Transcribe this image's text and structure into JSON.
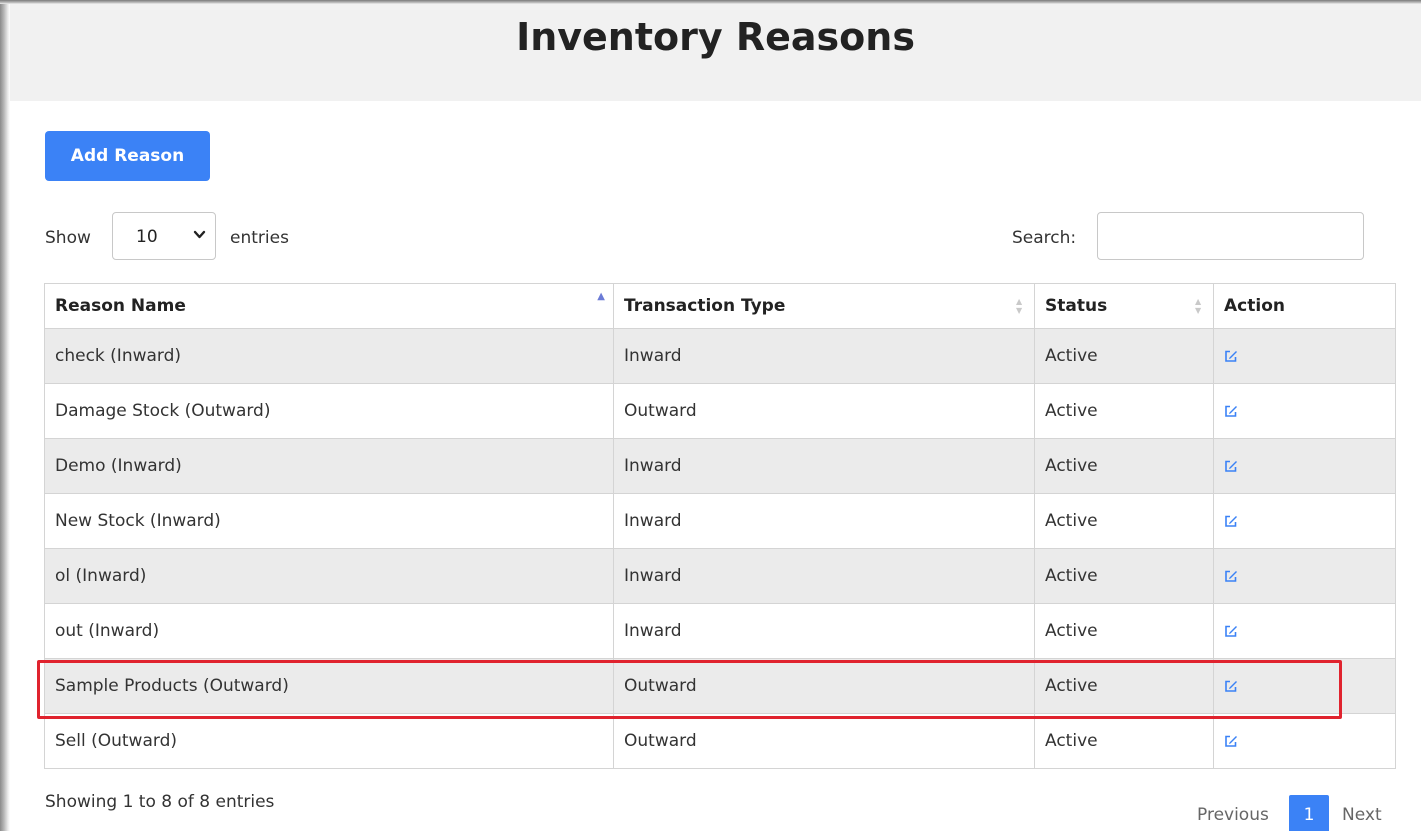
{
  "page": {
    "title": "Inventory Reasons"
  },
  "toolbar": {
    "add_label": "Add Reason"
  },
  "length_control": {
    "show_label": "Show",
    "value": "10",
    "suffix_label": "entries"
  },
  "search": {
    "label": "Search:",
    "value": ""
  },
  "table": {
    "columns": [
      "Reason Name",
      "Transaction Type",
      "Status",
      "Action"
    ],
    "sorted_column": "Reason Name",
    "sort_direction": "ascending",
    "rows": [
      {
        "reason": "check (Inward)",
        "type": "Inward",
        "status": "Active",
        "action_icon": "edit-icon"
      },
      {
        "reason": "Damage Stock (Outward)",
        "type": "Outward",
        "status": "Active",
        "action_icon": "edit-icon"
      },
      {
        "reason": "Demo (Inward)",
        "type": "Inward",
        "status": "Active",
        "action_icon": "edit-icon"
      },
      {
        "reason": "New Stock (Inward)",
        "type": "Inward",
        "status": "Active",
        "action_icon": "edit-icon"
      },
      {
        "reason": "ol (Inward)",
        "type": "Inward",
        "status": "Active",
        "action_icon": "edit-icon"
      },
      {
        "reason": "out (Inward)",
        "type": "Inward",
        "status": "Active",
        "action_icon": "edit-icon"
      },
      {
        "reason": "Sample Products (Outward)",
        "type": "Outward",
        "status": "Active",
        "action_icon": "edit-icon"
      },
      {
        "reason": "Sell (Outward)",
        "type": "Outward",
        "status": "Active",
        "action_icon": "edit-icon"
      }
    ],
    "highlighted_row": "Sample Products (Outward)"
  },
  "footer": {
    "info": "Showing 1 to 8 of 8 entries",
    "pagination": {
      "previous": "Previous",
      "current": "1",
      "next": "Next"
    }
  },
  "colors": {
    "accent": "#3b82f6",
    "highlight": "#e0232e",
    "row_stripe": "#ebebeb",
    "header_bg": "#f1f1f1"
  }
}
